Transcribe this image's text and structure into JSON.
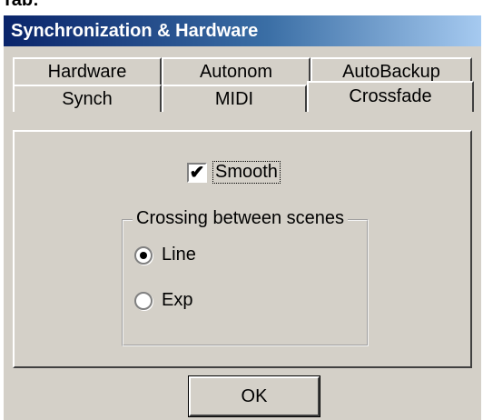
{
  "clipped_top_text": "Tab:",
  "window": {
    "title": "Synchronization & Hardware"
  },
  "tabs_row1": [
    {
      "label": "Hardware"
    },
    {
      "label": "Autonom"
    },
    {
      "label": "AutoBackup"
    }
  ],
  "tabs_row2": [
    {
      "label": "Synch"
    },
    {
      "label": "MIDI"
    },
    {
      "label": "Crossfade",
      "selected": true
    }
  ],
  "crossfade": {
    "smooth": {
      "label": "Smooth",
      "checked": true,
      "check_glyph": "✔"
    },
    "crossing_group": {
      "legend": "Crossing between scenes",
      "options": [
        {
          "label": "Line",
          "selected": true
        },
        {
          "label": "Exp",
          "selected": false
        }
      ]
    }
  },
  "buttons": {
    "ok": "OK"
  }
}
